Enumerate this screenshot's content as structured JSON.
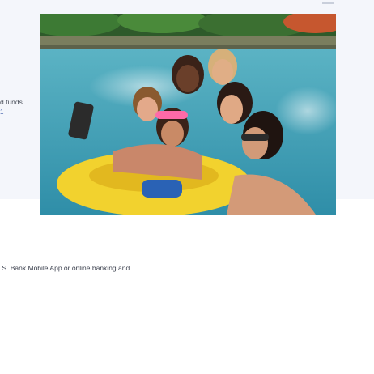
{
  "hero": {
    "fragment_funds": "d funds",
    "fragment_link": "1",
    "photo_icon": "group-selfie-on-inner-tube-photo"
  },
  "body": {
    "fragment_text": ".S. Bank Mobile App or online banking and"
  },
  "colors": {
    "band": "#f4f6fb",
    "water": "#3f9fb7",
    "tube": "#f2d22e"
  }
}
